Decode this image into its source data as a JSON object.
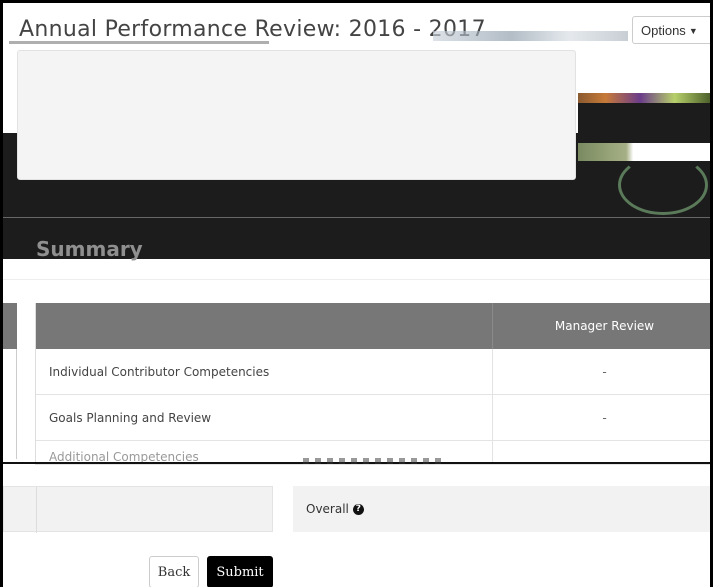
{
  "header": {
    "title": "Annual Performance Review: 2016 - 2017",
    "options_label": "Options"
  },
  "section": {
    "summary_label": "Summary"
  },
  "table": {
    "columns": [
      "",
      "Manager Review"
    ],
    "rows": [
      {
        "name": "Individual Contributor Competencies",
        "value": "-"
      },
      {
        "name": "Goals Planning and Review",
        "value": "-"
      },
      {
        "name": "Additional Competencies",
        "value": ""
      }
    ]
  },
  "footer": {
    "overall_label": "Overall",
    "help_icon_glyph": "?",
    "back_label": "Back",
    "submit_label": "Submit"
  }
}
